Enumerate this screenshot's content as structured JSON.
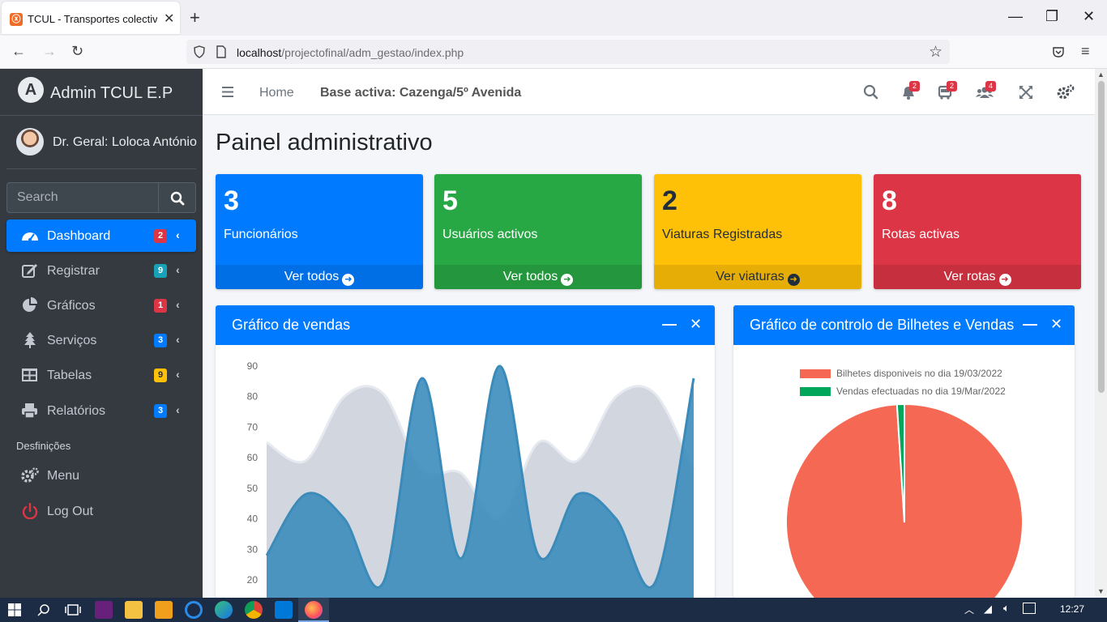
{
  "browser": {
    "tab_title": "TCUL - Transportes colectivos u",
    "tab_favicon": "xampp-icon",
    "url_host": "localhost",
    "url_path": "/projectofinal/adm_gestao/index.php"
  },
  "sidebar": {
    "brand": "Admin TCUL E.P",
    "user": "Dr. Geral: Loloca António",
    "search_placeholder": "Search",
    "items": [
      {
        "label": "Dashboard",
        "badge": "2",
        "badge_color": "#dc3545",
        "icon": "tachometer-icon",
        "active": true
      },
      {
        "label": "Registrar",
        "badge": "9",
        "badge_color": "#17a2b8",
        "icon": "edit-icon"
      },
      {
        "label": "Gráficos",
        "badge": "1",
        "badge_color": "#dc3545",
        "icon": "pie-chart-icon"
      },
      {
        "label": "Serviços",
        "badge": "3",
        "badge_color": "#007bff",
        "icon": "tree-icon"
      },
      {
        "label": "Tabelas",
        "badge": "9",
        "badge_color": "#ffc107",
        "icon": "table-icon"
      },
      {
        "label": "Relatórios",
        "badge": "3",
        "badge_color": "#007bff",
        "icon": "print-icon"
      }
    ],
    "section_header": "Desfinições",
    "extra_items": [
      {
        "label": "Menu",
        "icon": "cogs-icon"
      },
      {
        "label": "Log Out",
        "icon": "power-off-icon"
      }
    ]
  },
  "topnav": {
    "home": "Home",
    "base": "Base activa: Cazenga/5º Avenida",
    "bell_count": "2",
    "bus_count": "2",
    "users_count": "4"
  },
  "page_title": "Painel administrativo",
  "stats": [
    {
      "value": "3",
      "label": "Funcionários",
      "link": "Ver todos",
      "color": "#007bff",
      "foot": "#006fe6",
      "text": "#ffffff"
    },
    {
      "value": "5",
      "label": "Usuários activos",
      "link": "Ver todos",
      "color": "#28a745",
      "foot": "#24963e",
      "text": "#ffffff"
    },
    {
      "value": "2",
      "label": "Viaturas Registradas",
      "link": "Ver viaturas",
      "color": "#ffc107",
      "foot": "#e5ad06",
      "text": "#1f2d3d"
    },
    {
      "value": "8",
      "label": "Rotas activas",
      "link": "Ver rotas",
      "color": "#dc3545",
      "foot": "#c6303e",
      "text": "#ffffff"
    }
  ],
  "cards": {
    "sales_title": "Gráfico de vendas",
    "tickets_title": "Gráfico de controlo de Bilhetes e Vendas"
  },
  "chart_data": [
    {
      "type": "area",
      "title": "Gráfico de vendas",
      "yticks": [
        90,
        80,
        70,
        60,
        50,
        40,
        30,
        20
      ],
      "ylim": [
        10,
        95
      ],
      "series": [
        {
          "values": [
            65,
            59,
            80,
            81,
            56,
            55,
            40,
            65,
            59,
            80,
            81,
            56
          ],
          "color": "#d2d6de"
        },
        {
          "values": [
            28,
            48,
            40,
            19,
            86,
            27,
            90,
            28,
            48,
            40,
            19,
            86
          ],
          "color": "#3c8dbc"
        }
      ]
    },
    {
      "type": "pie",
      "title": "Gráfico de controlo de Bilhetes e Vendas",
      "legend_position": "top",
      "series": [
        {
          "name": "Bilhetes disponiveis no dia 19/03/2022",
          "value": 99,
          "color": "#f56954"
        },
        {
          "name": "Vendas efectuadas no dia 19/Mar/2022",
          "value": 1,
          "color": "#00a65a"
        }
      ]
    }
  ],
  "taskbar": {
    "time": "12:27"
  }
}
